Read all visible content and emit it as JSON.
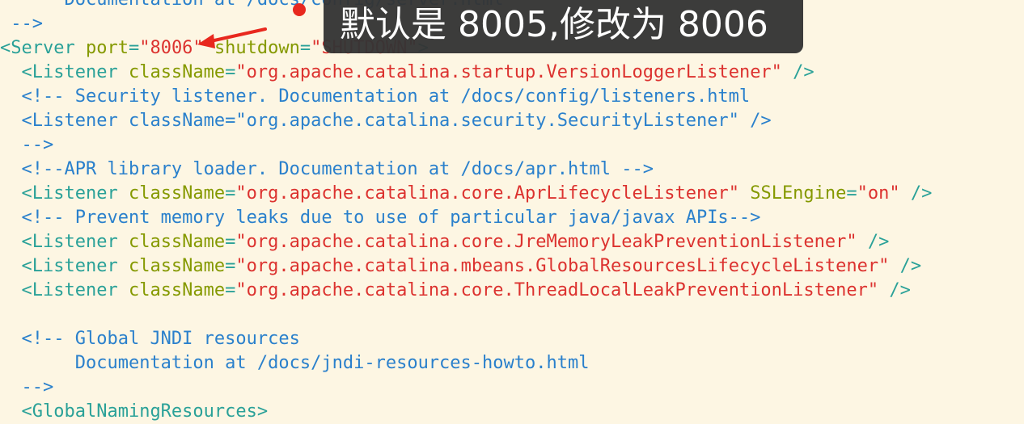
{
  "annotation": {
    "text": "默认是 8005,修改为 8006",
    "color_bg": "#343434",
    "color_arrow": "#e8281e"
  },
  "code": {
    "background": "#fdf6e3",
    "lines": [
      {
        "indent": "      ",
        "tokens": [
          {
            "t": "comment",
            "v": "Documentation at /docs/config/server.html"
          }
        ]
      },
      {
        "indent": " ",
        "tokens": [
          {
            "t": "comment",
            "v": "-->"
          }
        ]
      },
      {
        "indent": "",
        "tokens": [
          {
            "t": "tag",
            "v": "<Server "
          },
          {
            "t": "attr",
            "v": "port"
          },
          {
            "t": "punct",
            "v": "="
          },
          {
            "t": "string",
            "v": "\"8006\""
          },
          {
            "t": "punct",
            "v": " "
          },
          {
            "t": "attr",
            "v": "shutdown"
          },
          {
            "t": "punct",
            "v": "="
          },
          {
            "t": "string",
            "v": "\"SHUTDOWN\""
          },
          {
            "t": "tag",
            "v": ">"
          }
        ]
      },
      {
        "indent": "  ",
        "tokens": [
          {
            "t": "tag",
            "v": "<Listener "
          },
          {
            "t": "attr",
            "v": "className"
          },
          {
            "t": "punct",
            "v": "="
          },
          {
            "t": "string",
            "v": "\"org.apache.catalina.startup.VersionLoggerListener\""
          },
          {
            "t": "tag",
            "v": " />"
          }
        ]
      },
      {
        "indent": "  ",
        "tokens": [
          {
            "t": "comment",
            "v": "<!-- Security listener. Documentation at /docs/config/listeners.html"
          }
        ]
      },
      {
        "indent": "  ",
        "tokens": [
          {
            "t": "comment",
            "v": "<Listener className=\"org.apache.catalina.security.SecurityListener\" />"
          }
        ]
      },
      {
        "indent": "  ",
        "tokens": [
          {
            "t": "comment",
            "v": "-->"
          }
        ]
      },
      {
        "indent": "  ",
        "tokens": [
          {
            "t": "comment",
            "v": "<!--APR library loader. Documentation at /docs/apr.html -->"
          }
        ]
      },
      {
        "indent": "  ",
        "tokens": [
          {
            "t": "tag",
            "v": "<Listener "
          },
          {
            "t": "attr",
            "v": "className"
          },
          {
            "t": "punct",
            "v": "="
          },
          {
            "t": "string",
            "v": "\"org.apache.catalina.core.AprLifecycleListener\""
          },
          {
            "t": "punct",
            "v": " "
          },
          {
            "t": "attr",
            "v": "SSLEngine"
          },
          {
            "t": "punct",
            "v": "="
          },
          {
            "t": "string",
            "v": "\"on\""
          },
          {
            "t": "tag",
            "v": " />"
          }
        ]
      },
      {
        "indent": "  ",
        "tokens": [
          {
            "t": "comment",
            "v": "<!-- Prevent memory leaks due to use of particular java/javax APIs-->"
          }
        ]
      },
      {
        "indent": "  ",
        "tokens": [
          {
            "t": "tag",
            "v": "<Listener "
          },
          {
            "t": "attr",
            "v": "className"
          },
          {
            "t": "punct",
            "v": "="
          },
          {
            "t": "string",
            "v": "\"org.apache.catalina.core.JreMemoryLeakPreventionListener\""
          },
          {
            "t": "tag",
            "v": " />"
          }
        ]
      },
      {
        "indent": "  ",
        "tokens": [
          {
            "t": "tag",
            "v": "<Listener "
          },
          {
            "t": "attr",
            "v": "className"
          },
          {
            "t": "punct",
            "v": "="
          },
          {
            "t": "string",
            "v": "\"org.apache.catalina.mbeans.GlobalResourcesLifecycleListener\""
          },
          {
            "t": "tag",
            "v": " />"
          }
        ]
      },
      {
        "indent": "  ",
        "tokens": [
          {
            "t": "tag",
            "v": "<Listener "
          },
          {
            "t": "attr",
            "v": "className"
          },
          {
            "t": "punct",
            "v": "="
          },
          {
            "t": "string",
            "v": "\"org.apache.catalina.core.ThreadLocalLeakPreventionListener\""
          },
          {
            "t": "tag",
            "v": " />"
          }
        ]
      },
      {
        "indent": "",
        "tokens": []
      },
      {
        "indent": "  ",
        "tokens": [
          {
            "t": "comment",
            "v": "<!-- Global JNDI resources"
          }
        ]
      },
      {
        "indent": "       ",
        "tokens": [
          {
            "t": "comment",
            "v": "Documentation at /docs/jndi-resources-howto.html"
          }
        ]
      },
      {
        "indent": "  ",
        "tokens": [
          {
            "t": "comment",
            "v": "-->"
          }
        ]
      },
      {
        "indent": "  ",
        "tokens": [
          {
            "t": "tag",
            "v": "<GlobalNamingResources>"
          }
        ]
      }
    ]
  }
}
